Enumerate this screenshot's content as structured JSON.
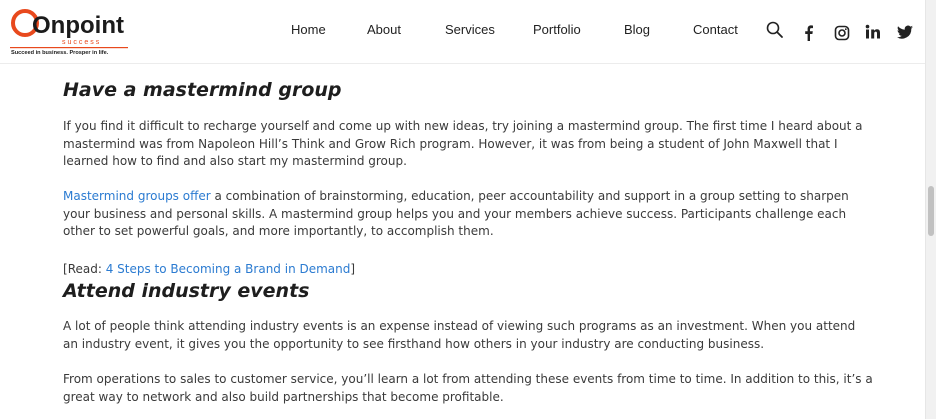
{
  "logo": {
    "brand": "Onpoint",
    "sub": "success",
    "tagline": "Succeed in business. Prosper in life."
  },
  "nav": [
    "Home",
    "About",
    "Services",
    "Portfolio",
    "Blog",
    "Contact"
  ],
  "icons": [
    "search-icon",
    "facebook-icon",
    "instagram-icon",
    "linkedin-icon",
    "twitter-icon"
  ],
  "colors": {
    "accent": "#e8491d",
    "link": "#2b7bd1",
    "heading": "#1e1e1e"
  },
  "article": {
    "h1": "Have a mastermind group",
    "p1": "If you find it difficult to recharge yourself and come up with new ideas, try joining a mastermind group. The first time I heard about a mastermind was from Napoleon Hill’s Think and Grow Rich program. However, it was from being a student of John Maxwell that I learned how to find and also start my mastermind group.",
    "p2_link": "Mastermind groups offer",
    "p2_rest": " a combination of brainstorming, education, peer accountability and support in a group setting to sharpen your business and personal skills. A mastermind group helps you and your members achieve success. Participants challenge each other to set powerful goals, and more importantly, to accomplish them.",
    "read_open": "[",
    "read_label": "Read: ",
    "read_link": "4 Steps to Becoming a Brand in Demand",
    "read_close": "]",
    "h2": "Attend industry events",
    "p3": "A lot of people think attending industry events is an expense instead of viewing such programs as an investment. When you attend an industry event, it gives you the opportunity to see firsthand how others in your industry are conducting business.",
    "p4": "From operations to sales to customer service, you’ll learn a lot from attending these events from time to time. In addition to this, it’s a great way to network and also build partnerships that become profitable."
  }
}
